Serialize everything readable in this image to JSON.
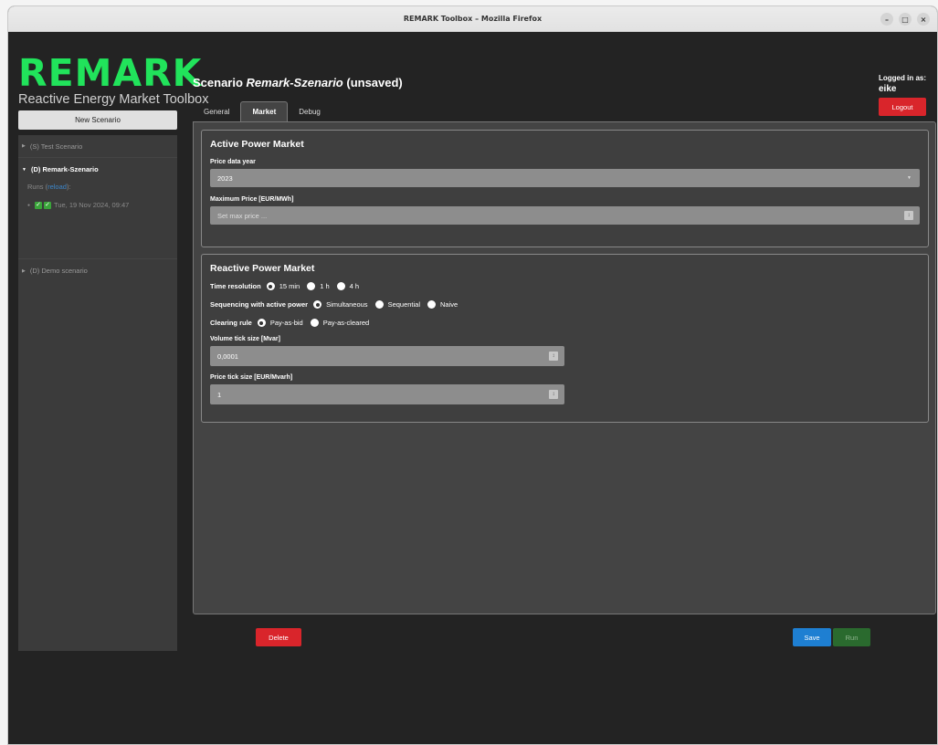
{
  "window": {
    "title": "REMARK Toolbox – Mozilla Firefox",
    "controls": [
      "–",
      "□",
      "×"
    ]
  },
  "brand": {
    "logo": "REMARK",
    "subtitle": "Reactive Energy Market Toolbox"
  },
  "sidebar": {
    "new_button": "New Scenario",
    "items": [
      {
        "label": "(S) Test Scenario"
      },
      {
        "label": "(D) Remark-Szenario"
      },
      {
        "label": "(D) Demo scenario"
      }
    ],
    "runs_label": "Runs (",
    "reload_label": "reload",
    "runs_suffix": "):",
    "run_entry": "Tue, 19 Nov 2024, 09:47"
  },
  "header": {
    "title_prefix": "Scenario ",
    "title_name": "Remark-Szenario",
    "title_suffix": " (unsaved)",
    "logged_in_label": "Logged in as:",
    "username": "eike",
    "logout": "Logout"
  },
  "tabs": [
    {
      "label": "General"
    },
    {
      "label": "Market"
    },
    {
      "label": "Debug"
    }
  ],
  "active_market": {
    "title": "Active Power Market",
    "price_year_label": "Price data year",
    "price_year_value": "2023",
    "max_price_label": "Maximum Price [EUR/MWh]",
    "max_price_placeholder": "Set max price ..."
  },
  "reactive_market": {
    "title": "Reactive Power Market",
    "time_resolution_label": "Time resolution",
    "time_resolution_options": [
      "15 min",
      "1 h",
      "4 h"
    ],
    "sequencing_label": "Sequencing with active power",
    "sequencing_options": [
      "Simultaneous",
      "Sequential",
      "Naive"
    ],
    "clearing_label": "Clearing rule",
    "clearing_options": [
      "Pay-as-bid",
      "Pay-as-cleared"
    ],
    "volume_tick_label": "Volume tick size [Mvar]",
    "volume_tick_value": "0,0001",
    "price_tick_label": "Price tick size [EUR/Mvarh]",
    "price_tick_value": "1"
  },
  "actions": {
    "delete": "Delete",
    "save": "Save",
    "run": "Run"
  },
  "colors": {
    "brand_green": "#21e35b",
    "danger": "#d9252b",
    "primary": "#1e7fd2",
    "run_disabled": "#2a6a2e"
  }
}
